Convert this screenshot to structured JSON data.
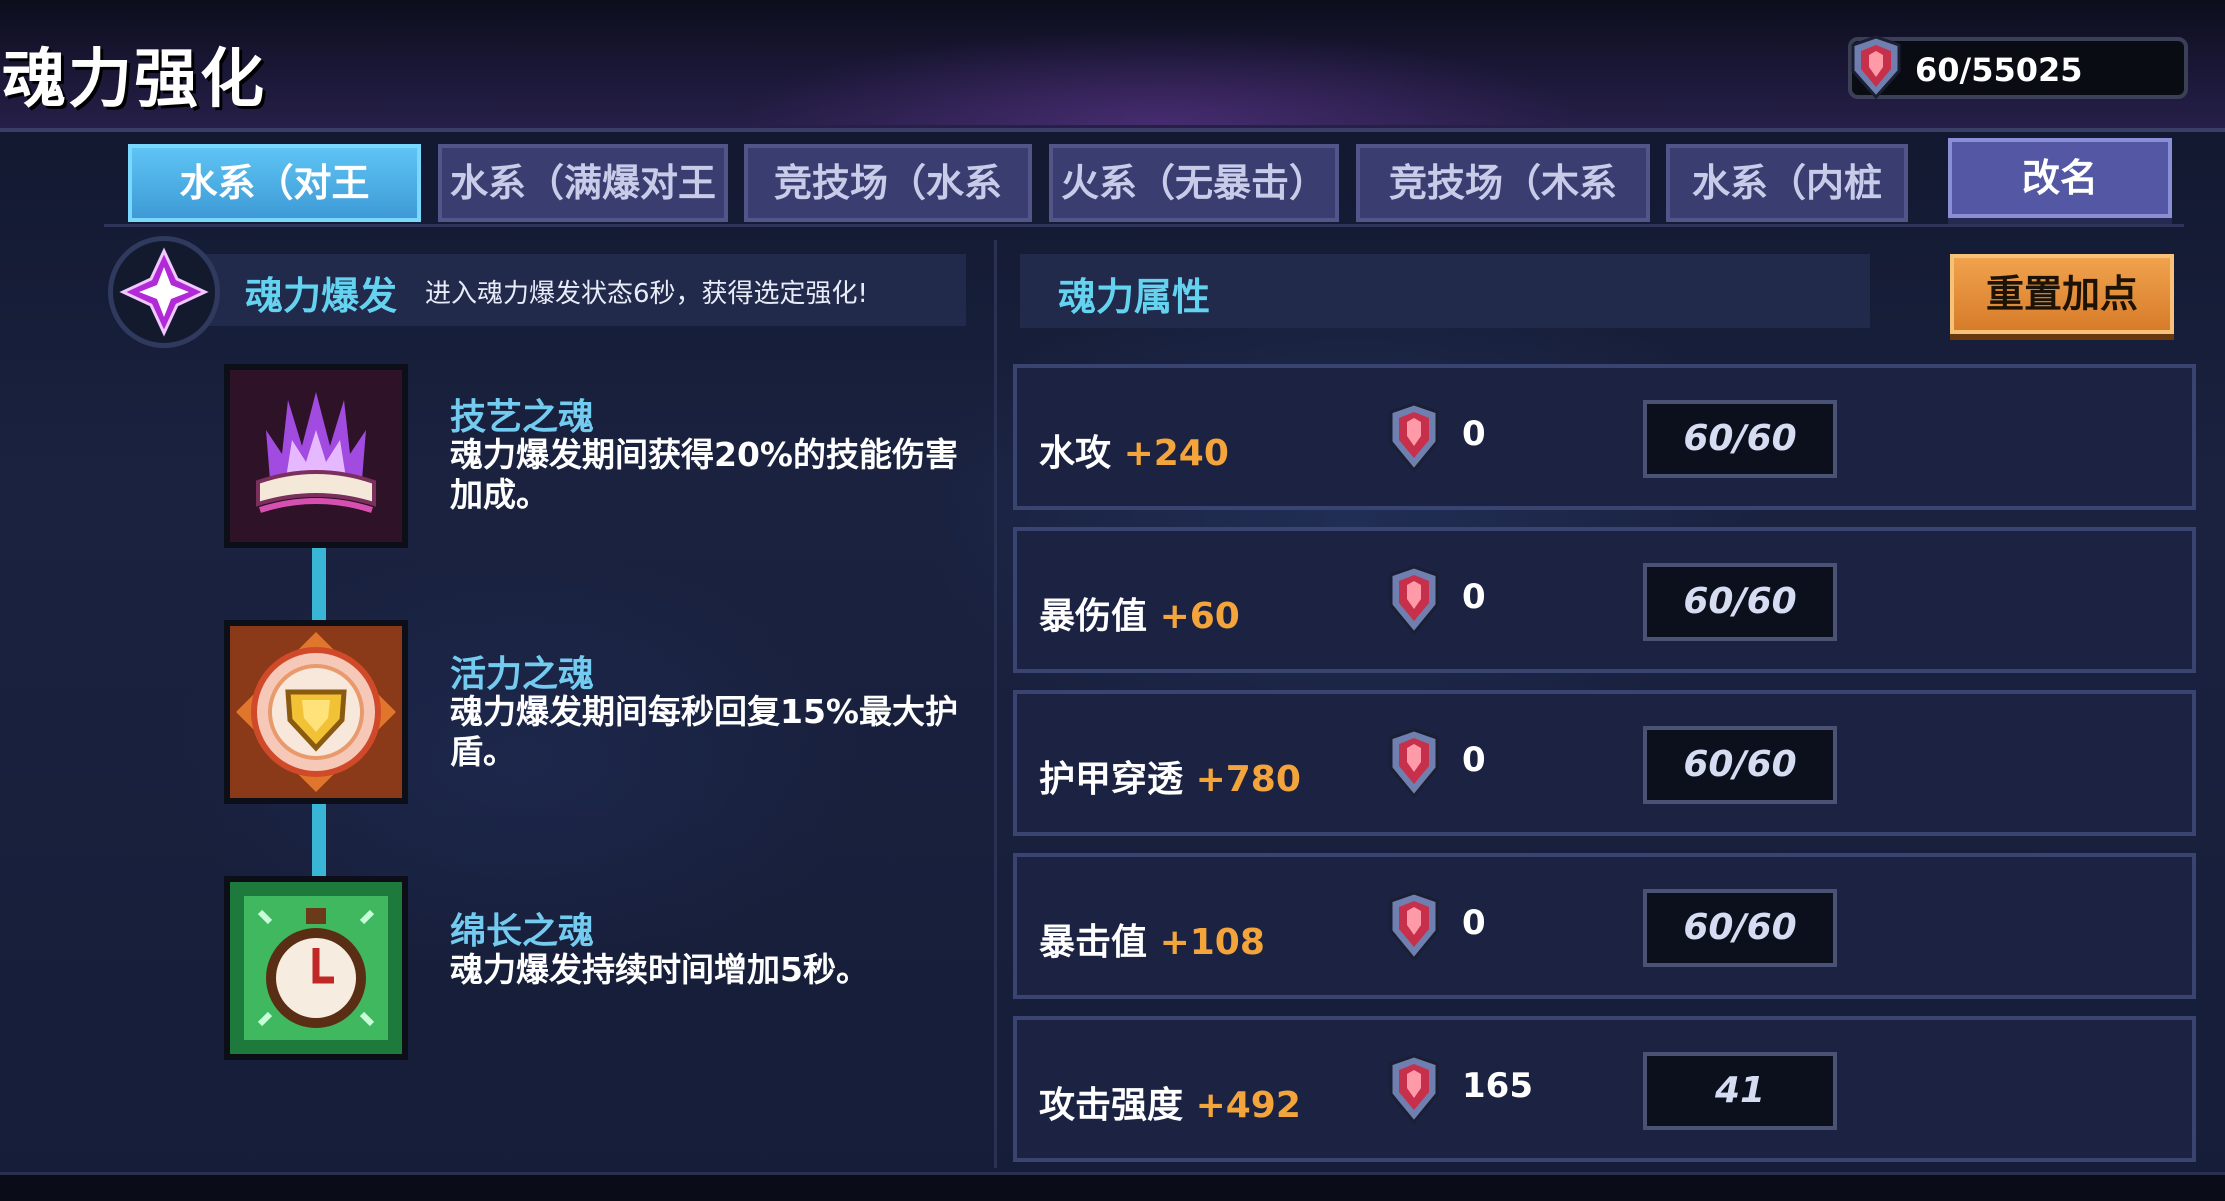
{
  "header": {
    "title": "魂力强化",
    "soul_points": "60/55025"
  },
  "tabs": [
    {
      "label": "水系（对王",
      "active": true
    },
    {
      "label": "水系（满爆对王",
      "active": false
    },
    {
      "label": "竞技场（水系",
      "active": false
    },
    {
      "label": "火系（无暴击）",
      "active": false
    },
    {
      "label": "竞技场（木系",
      "active": false
    },
    {
      "label": "水系（内桩",
      "active": false
    }
  ],
  "rename_label": "改名",
  "burst": {
    "title": "魂力爆发",
    "description": "进入魂力爆发状态6秒，获得选定强化!"
  },
  "skills": [
    {
      "name": "技艺之魂",
      "description": "魂力爆发期间获得20%的技能伤害加成。",
      "icon": "purple-flame-book-icon"
    },
    {
      "name": "活力之魂",
      "description": "魂力爆发期间每秒回复15%最大护盾。",
      "icon": "golden-shield-icon"
    },
    {
      "name": "绵长之魂",
      "description": "魂力爆发持续时间增加5秒。",
      "icon": "green-stopwatch-icon"
    }
  ],
  "attributes_panel": {
    "title": "魂力属性",
    "reset_label": "重置加点"
  },
  "attributes": [
    {
      "name": "水攻",
      "bonus": "+240",
      "cost": "0",
      "level": "60/60"
    },
    {
      "name": "暴伤值",
      "bonus": "+60",
      "cost": "0",
      "level": "60/60"
    },
    {
      "name": "护甲穿透",
      "bonus": "+780",
      "cost": "0",
      "level": "60/60"
    },
    {
      "name": "暴击值",
      "bonus": "+108",
      "cost": "0",
      "level": "60/60"
    },
    {
      "name": "攻击强度",
      "bonus": "+492",
      "cost": "165",
      "level": "41"
    }
  ],
  "colors": {
    "accent_cyan": "#64d3f0",
    "bonus_orange": "#f3a43a",
    "active_tab": "#5ec4f4",
    "reset_button": "#e08a36"
  }
}
